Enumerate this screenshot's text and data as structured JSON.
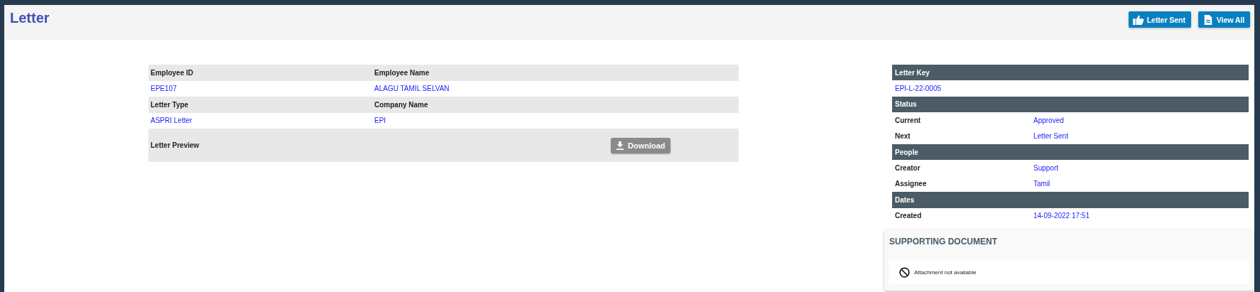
{
  "page": {
    "title": "Letter"
  },
  "actions": [
    {
      "label": "Letter Sent",
      "kind": "approve"
    },
    {
      "label": "View All",
      "kind": "list"
    }
  ],
  "details": {
    "rows": [
      {
        "kind": "header",
        "cells": [
          "Employee ID",
          "Employee Name"
        ]
      },
      {
        "kind": "value",
        "cells": [
          "EPE107",
          "ALAGU TAMIL SELVAN"
        ]
      },
      {
        "kind": "header",
        "cells": [
          "Letter Type",
          "Company Name"
        ]
      },
      {
        "kind": "value",
        "cells": [
          "ASPRI Letter",
          "EPI"
        ]
      }
    ],
    "preview": {
      "label": "Letter Preview",
      "button": "Download"
    }
  },
  "summary": [
    {
      "kind": "section",
      "label": "Letter Key"
    },
    {
      "kind": "single",
      "value": "EPI-L-22-0005"
    },
    {
      "kind": "section",
      "label": "Status"
    },
    {
      "kind": "pair",
      "label": "Current",
      "value": "Approved"
    },
    {
      "kind": "pair",
      "label": "Next",
      "value": "Letter Sent"
    },
    {
      "kind": "section",
      "label": "People"
    },
    {
      "kind": "pair",
      "label": "Creator",
      "value": "Support"
    },
    {
      "kind": "pair",
      "label": "Assignee",
      "value": "Tamil"
    },
    {
      "kind": "section",
      "label": "Dates"
    },
    {
      "kind": "pair",
      "label": "Created",
      "value": "14-09-2022 17:51"
    }
  ],
  "supporting_document": {
    "title": "SUPPORTING DOCUMENT",
    "message": "Attachment not available"
  }
}
